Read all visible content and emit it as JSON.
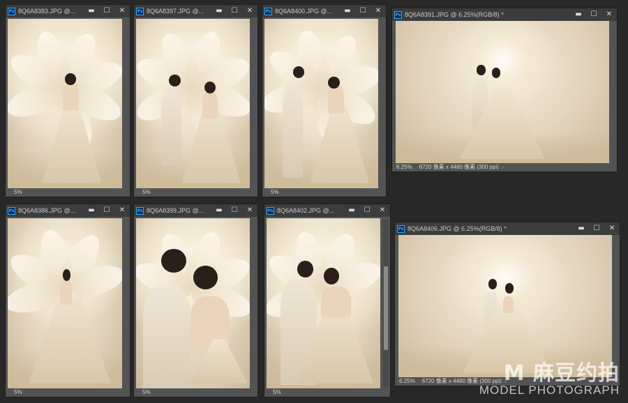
{
  "windows": [
    {
      "id": "w1",
      "title": "8Q6A8383.JPG @...",
      "zoom": "5%",
      "dims": ""
    },
    {
      "id": "w2",
      "title": "8Q6A8397.JPG @...",
      "zoom": "5%",
      "dims": ""
    },
    {
      "id": "w3",
      "title": "8Q6A8400.JPG @...",
      "zoom": "5%",
      "dims": ""
    },
    {
      "id": "w4",
      "title": "8Q6A8391.JPG @ 6.25%(RGB/8) *",
      "zoom": "6.25%",
      "dims": "6720 像素 x 4480 像素 (300 ppi)"
    },
    {
      "id": "w5",
      "title": "8Q6A8386.JPG @...",
      "zoom": "5%",
      "dims": ""
    },
    {
      "id": "w6",
      "title": "8Q6A8399.JPG @...",
      "zoom": "5%",
      "dims": ""
    },
    {
      "id": "w7",
      "title": "8Q6A8402.JPG @...",
      "zoom": "5%",
      "dims": ""
    },
    {
      "id": "w8",
      "title": "8Q6A8406.JPG @ 6.25%(RGB/8) *",
      "zoom": "6.25%",
      "dims": "6720 像素 x 4480 像素 (300 ppi)"
    }
  ],
  "controls": {
    "minimize": "▬",
    "maximize": "☐",
    "close": "✕",
    "ps_badge": "Ps",
    "arrow": "›"
  },
  "watermark": {
    "line1": "M 麻豆约拍",
    "line2": "MODEL PHOTOGRAPH"
  },
  "colors": {
    "background": "#282828",
    "titlebar": "#3c3c3c",
    "panel": "#535353",
    "ps_accent": "#31a8ff"
  }
}
